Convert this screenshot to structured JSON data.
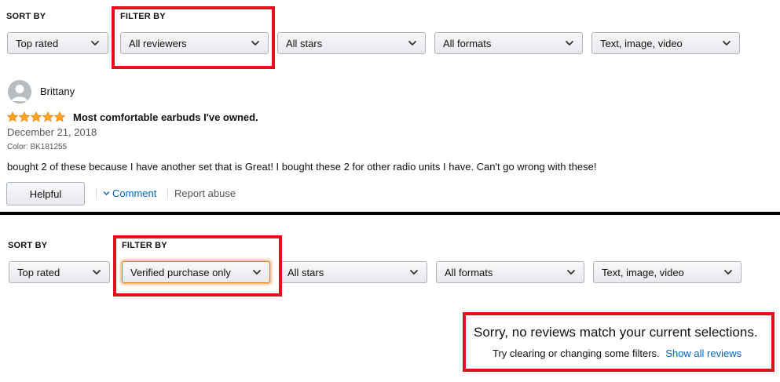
{
  "top_panel": {
    "sort_label": "SORT BY",
    "filter_label": "FILTER BY",
    "sort_value": "Top rated",
    "reviewer_filter": "All reviewers",
    "stars_filter": "All stars",
    "formats_filter": "All formats",
    "media_filter": "Text, image, video"
  },
  "review": {
    "author": "Brittany",
    "rating": 5,
    "title": "Most comfortable earbuds I've owned.",
    "date": "December 21, 2018",
    "variant": "Color: BK181255",
    "body": "bought 2 of these because I have another set that is Great! I bought these 2 for other radio units I have. Can't go wrong with these!",
    "helpful_label": "Helpful",
    "comment_label": "Comment",
    "report_label": "Report abuse"
  },
  "bottom_panel": {
    "sort_label": "SORT BY",
    "filter_label": "FILTER BY",
    "sort_value": "Top rated",
    "reviewer_filter": "Verified purchase only",
    "stars_filter": "All stars",
    "formats_filter": "All formats",
    "media_filter": "Text, image, video"
  },
  "empty_state": {
    "message": "Sorry, no reviews match your current selections.",
    "hint": "Try clearing or changing some filters.",
    "link": "Show all reviews"
  },
  "colors": {
    "highlight": "#e3101d",
    "star": "#ffa41c",
    "link": "#0066c0",
    "focus": "#e77600"
  },
  "icons": {
    "dropdown": "chevron-down-icon",
    "avatar": "user-avatar-icon",
    "star": "star-icon",
    "comment": "chevron-down-icon"
  }
}
